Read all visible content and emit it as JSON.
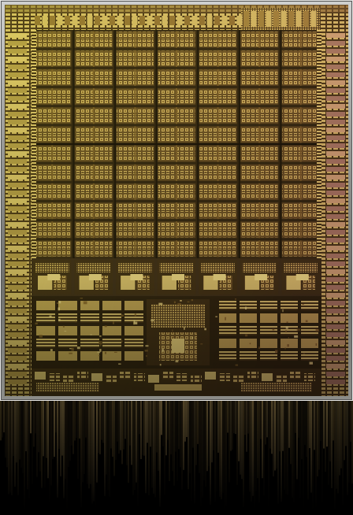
{
  "image": {
    "subject": "GPU die shot",
    "colors": {
      "frame_light": "#cfd0cf",
      "frame_dark": "#6f706c",
      "die_base": "#3a311c",
      "gold_light": "#d9c27a",
      "gold_mid": "#a8924e",
      "gold_dark": "#5e4f28",
      "copper": "#b88a5c",
      "violet_tint": "#8a6f6a",
      "green_tint": "#9c9b55"
    },
    "main_grid": {
      "columns": 7,
      "rows": 12
    },
    "reflection": true
  }
}
